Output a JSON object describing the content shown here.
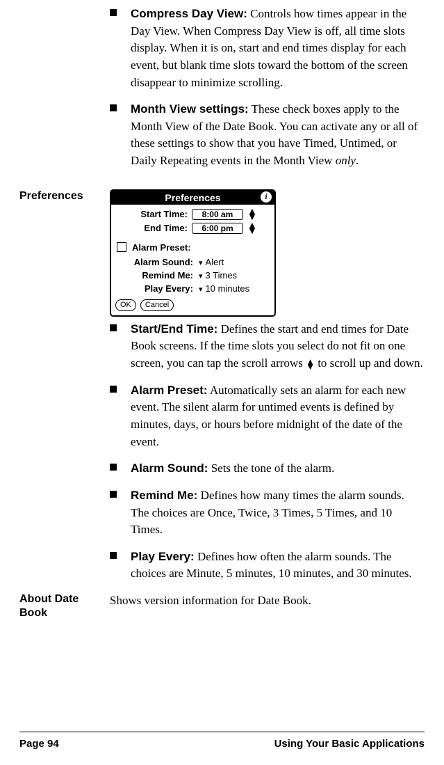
{
  "section_top": {
    "items": [
      {
        "title": "Compress Day View:",
        "body": "Controls how times appear in the Day View. When Compress Day View is off, all time slots display. When it is on, start and end times display for each event, but blank time slots toward the bottom of the screen disappear to minimize scrolling."
      },
      {
        "title": "Month View settings:",
        "body_pre": "These check boxes apply to the Month View of the Date Book. You can activate any or all of these settings to show that you have Timed, Untimed, or Daily Repeating events in the Month View ",
        "body_ital": "only",
        "body_post": "."
      }
    ]
  },
  "preferences_heading": "Preferences",
  "palm": {
    "title": "Preferences",
    "start_label": "Start Time:",
    "start_value": "8:00 am",
    "end_label": "End Time:",
    "end_value": "6:00 pm",
    "alarm_preset_label": "Alarm Preset:",
    "alarm_sound_label": "Alarm Sound:",
    "alarm_sound_value": "Alert",
    "remind_label": "Remind Me:",
    "remind_value": "3 Times",
    "play_label": "Play Every:",
    "play_value": "10 minutes",
    "ok": "OK",
    "cancel": "Cancel"
  },
  "preferences_items": [
    {
      "title": "Start/End Time:",
      "body_pre": "Defines the start and end times for Date Book screens. If the time slots you select do not fit on one screen, you can tap the scroll arrows ",
      "body_post": " to scroll up and down.",
      "has_scroll_glyph": true
    },
    {
      "title": "Alarm Preset:",
      "body": "Automatically sets an alarm for each new event. The silent alarm for untimed events is defined by minutes, days, or hours before midnight of the date of the event."
    },
    {
      "title": "Alarm Sound:",
      "body": "Sets the tone of the alarm."
    },
    {
      "title": "Remind Me:",
      "body": "Defines how many times the alarm sounds. The choices are Once, Twice, 3 Times, 5 Times, and 10 Times."
    },
    {
      "title": "Play Every:",
      "body": "Defines how often the alarm sounds. The choices are Minute, 5 minutes, 10 minutes, and 30 minutes."
    }
  ],
  "about_heading": "About Date Book",
  "about_body": "Shows version information for Date Book.",
  "footer": {
    "left": "Page 94",
    "right": "Using Your Basic Applications"
  }
}
